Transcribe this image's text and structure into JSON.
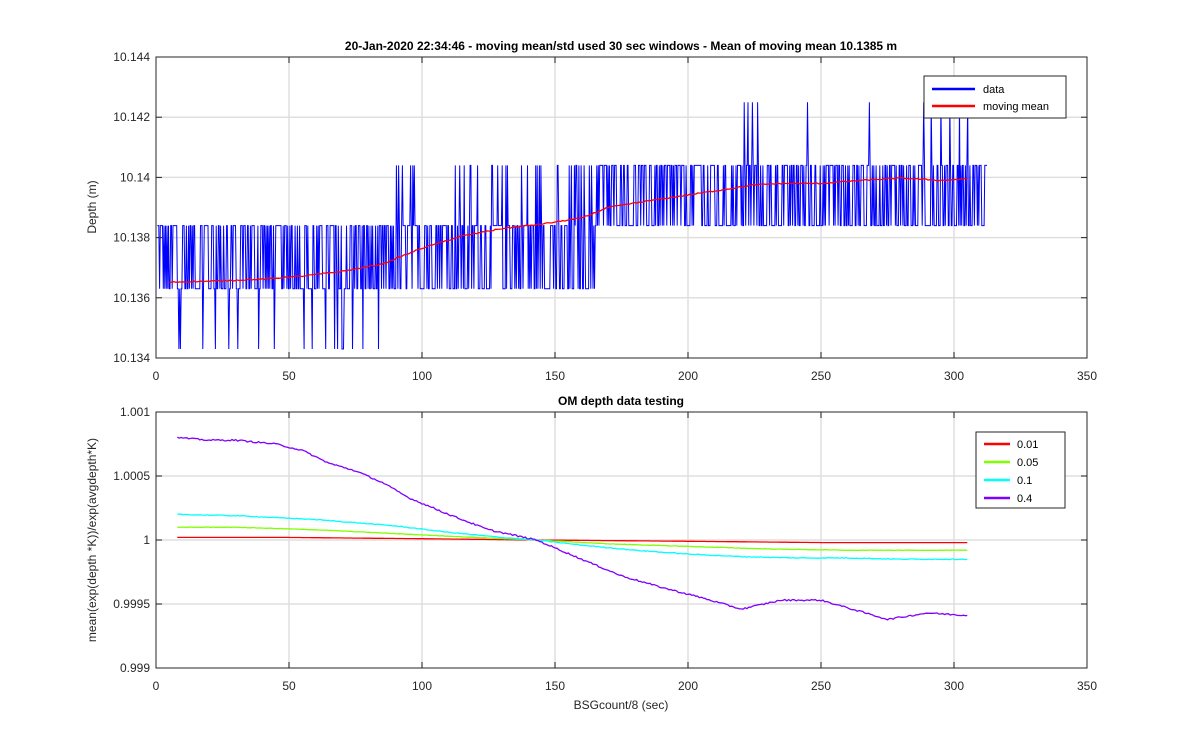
{
  "chart_data": [
    {
      "type": "line",
      "title": "20-Jan-2020 22:34:46 - moving mean/std used 30 sec windows - Mean of moving mean 10.1385 m",
      "xlabel": "",
      "ylabel": "Depth (m)",
      "xlim": [
        0,
        350
      ],
      "ylim": [
        10.134,
        10.144
      ],
      "xticks": [
        0,
        50,
        100,
        150,
        200,
        250,
        300,
        350
      ],
      "xtick_labels": [
        "0",
        "50",
        "100",
        "150",
        "200",
        "250",
        "300",
        "350"
      ],
      "yticks": [
        10.134,
        10.136,
        10.138,
        10.14,
        10.142,
        10.144
      ],
      "ytick_labels": [
        "10.134",
        "10.136",
        "10.138",
        "10.14",
        "10.142",
        "10.144"
      ],
      "grid": true,
      "legend_position": "top-right",
      "series": [
        {
          "name": "data",
          "color": "#0000ff",
          "kind": "quantized-noise",
          "x_range": [
            0.5,
            312.5
          ],
          "levels": [
            10.1343,
            10.1363,
            10.1384,
            10.1404,
            10.1425
          ],
          "dominant_segments": [
            {
              "x": [
                0.5,
                90
              ],
              "levels": [
                10.1363,
                10.1384
              ]
            },
            {
              "x": [
                90,
                165
              ],
              "levels": [
                10.1363,
                10.1384,
                10.1404
              ]
            },
            {
              "x": [
                165,
                312.5
              ],
              "levels": [
                10.1384,
                10.1404
              ]
            }
          ]
        },
        {
          "name": "moving mean",
          "color": "#ff0000",
          "x": [
            5,
            20,
            40,
            55,
            70,
            85,
            100,
            115,
            130,
            145,
            160,
            170,
            180,
            195,
            210,
            225,
            235,
            250,
            265,
            280,
            295,
            305
          ],
          "y": [
            10.13652,
            10.13655,
            10.13662,
            10.13672,
            10.13688,
            10.13712,
            10.13765,
            10.13805,
            10.1383,
            10.13845,
            10.13865,
            10.139,
            10.13915,
            10.13935,
            10.13955,
            10.13975,
            10.1398,
            10.1398,
            10.1399,
            10.13998,
            10.1399,
            10.13995
          ]
        }
      ]
    },
    {
      "type": "line",
      "title": "OM depth data testing",
      "xlabel": "BSGcount/8 (sec)",
      "ylabel": "mean(exp(depth *K))/exp(avgdepth*K)",
      "xlim": [
        0,
        350
      ],
      "ylim": [
        0.999,
        1.001
      ],
      "xticks": [
        0,
        50,
        100,
        150,
        200,
        250,
        300,
        350
      ],
      "xtick_labels": [
        "0",
        "50",
        "100",
        "150",
        "200",
        "250",
        "300",
        "350"
      ],
      "yticks": [
        0.999,
        0.9995,
        1,
        1.0005,
        1.001
      ],
      "ytick_labels": [
        "0.999",
        "0.9995",
        "1",
        "1.0005",
        "1.001"
      ],
      "grid": true,
      "legend_position": "top-right",
      "series": [
        {
          "name": "0.01",
          "color": "#ff0000",
          "x": [
            8,
            50,
            100,
            143,
            200,
            250,
            305
          ],
          "y": [
            1.00002,
            1.00002,
            1.00001,
            1.0,
            0.99999,
            0.99998,
            0.99998
          ]
        },
        {
          "name": "0.05",
          "color": "#80ff00",
          "x": [
            8,
            30,
            60,
            90,
            120,
            143,
            170,
            200,
            230,
            260,
            305
          ],
          "y": [
            1.0001,
            1.0001,
            1.00008,
            1.00005,
            1.00002,
            1.0,
            0.99997,
            0.99995,
            0.99993,
            0.99992,
            0.99992
          ]
        },
        {
          "name": "0.1",
          "color": "#00ffff",
          "x": [
            8,
            30,
            60,
            90,
            110,
            130,
            143,
            160,
            180,
            200,
            220,
            240,
            260,
            280,
            305
          ],
          "y": [
            1.0002,
            1.00019,
            1.00016,
            1.00011,
            1.00006,
            1.00002,
            1.0,
            0.99996,
            0.99992,
            0.99989,
            0.99987,
            0.99986,
            0.99986,
            0.99985,
            0.99985
          ]
        },
        {
          "name": "0.4",
          "color": "#8000ff",
          "x": [
            8,
            20,
            30,
            45,
            55,
            65,
            75,
            85,
            95,
            110,
            125,
            143,
            160,
            175,
            190,
            205,
            220,
            235,
            250,
            265,
            275,
            290,
            305
          ],
          "y": [
            1.0008,
            1.00078,
            1.00078,
            1.00075,
            1.0007,
            1.0006,
            1.00054,
            1.00045,
            1.00033,
            1.0002,
            1.00008,
            1.0,
            0.99985,
            0.99972,
            0.99963,
            0.99955,
            0.99946,
            0.99953,
            0.99953,
            0.99944,
            0.99938,
            0.99943,
            0.99941
          ]
        }
      ]
    }
  ]
}
